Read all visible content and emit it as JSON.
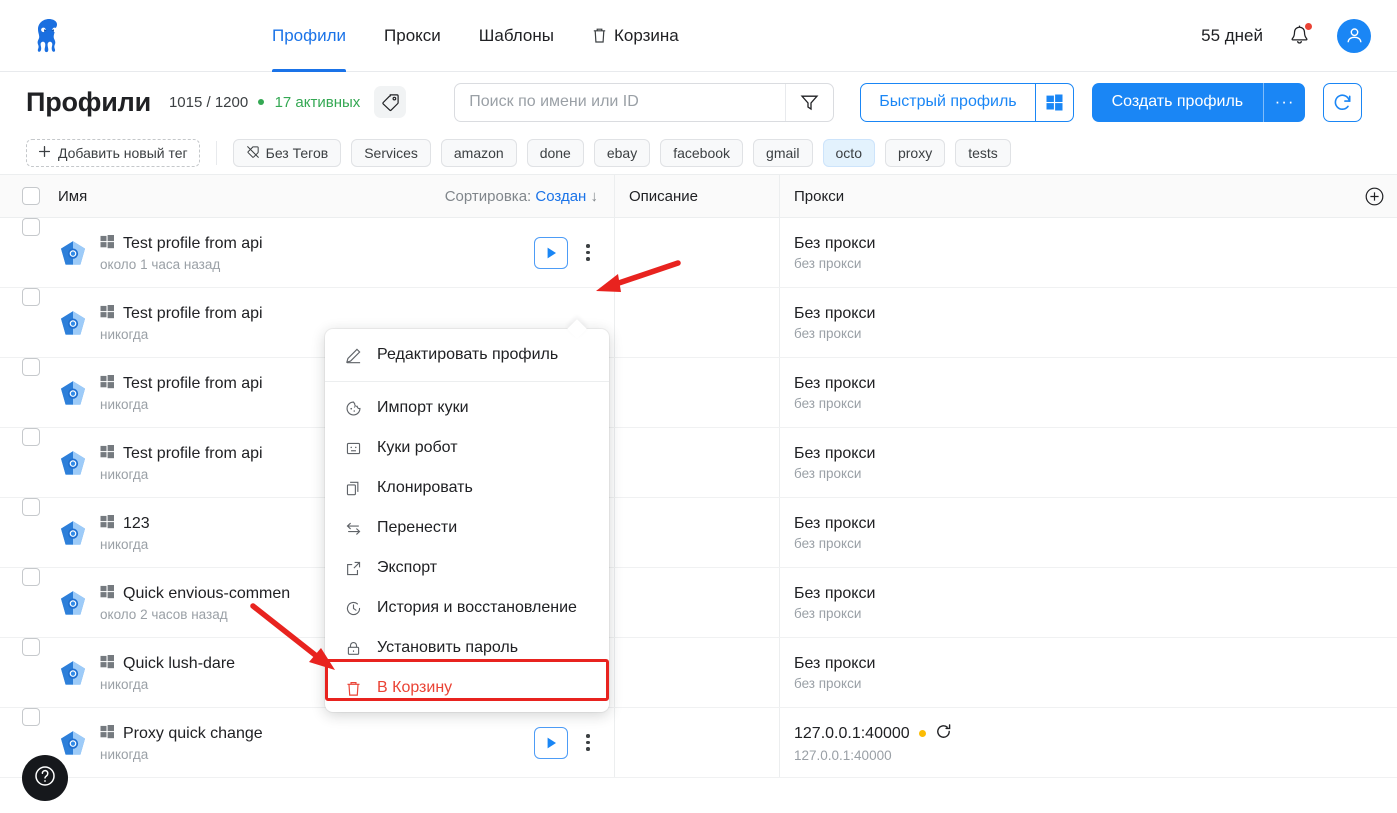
{
  "header": {
    "logo_icon": "octo-browser-logo",
    "nav": [
      {
        "label": "Профили",
        "icon": null,
        "active": true
      },
      {
        "label": "Прокси",
        "icon": null,
        "active": false
      },
      {
        "label": "Шаблоны",
        "icon": null,
        "active": false
      },
      {
        "label": "Корзина",
        "icon": "trash-icon",
        "active": false
      }
    ],
    "days_left": "55 дней",
    "bell_icon": "notification-bell-icon",
    "has_notification": true,
    "avatar_icon": "user-avatar-icon"
  },
  "toolbar": {
    "title": "Профили",
    "count": "1015 / 1200",
    "active_count": "17 активных",
    "tag_icon": "tag-icon",
    "search_placeholder": "Поиск по имени или ID",
    "search_value": "",
    "filter_icon": "funnel-icon",
    "quick_profile_label": "Быстрый профиль",
    "windows_icon": "windows-icon",
    "create_profile_label": "Создать профиль",
    "more_label": "···",
    "refresh_icon": "refresh-icon"
  },
  "tags": {
    "add_label": "Добавить новый тег",
    "no_tag_label": "Без Тегов",
    "no_tag_icon": "tag-off-icon",
    "items": [
      {
        "label": "Services",
        "selected": false
      },
      {
        "label": "amazon",
        "selected": false
      },
      {
        "label": "done",
        "selected": false
      },
      {
        "label": "ebay",
        "selected": false
      },
      {
        "label": "facebook",
        "selected": false
      },
      {
        "label": "gmail",
        "selected": false
      },
      {
        "label": "octo",
        "selected": true
      },
      {
        "label": "proxy",
        "selected": false
      },
      {
        "label": "tests",
        "selected": false
      }
    ]
  },
  "table": {
    "columns": {
      "name": "Имя",
      "description": "Описание",
      "proxy": "Прокси"
    },
    "sort_label": "Сортировка:",
    "sort_value": "Создан",
    "sort_dir_icon": "arrow-down-icon",
    "add_column_icon": "plus-circle-icon",
    "rows": [
      {
        "name": "Test profile from api",
        "time": "около 1 часа назад",
        "os_icon": "windows-icon",
        "browser_icon": "octo-profile-icon",
        "proxy": "Без прокси",
        "proxy_sub": "без прокси",
        "proxy_status": null
      },
      {
        "name": "Test profile from api",
        "time": "никогда",
        "os_icon": "windows-icon",
        "browser_icon": "octo-profile-icon",
        "proxy": "Без прокси",
        "proxy_sub": "без прокси",
        "proxy_status": null
      },
      {
        "name": "Test profile from api",
        "time": "никогда",
        "os_icon": "windows-icon",
        "browser_icon": "octo-profile-icon",
        "proxy": "Без прокси",
        "proxy_sub": "без прокси",
        "proxy_status": null
      },
      {
        "name": "Test profile from api",
        "time": "никогда",
        "os_icon": "windows-icon",
        "browser_icon": "octo-profile-icon",
        "proxy": "Без прокси",
        "proxy_sub": "без прокси",
        "proxy_status": null
      },
      {
        "name": "123",
        "time": "никогда",
        "os_icon": "windows-icon",
        "browser_icon": "octo-profile-icon",
        "proxy": "Без прокси",
        "proxy_sub": "без прокси",
        "proxy_status": null
      },
      {
        "name": "Quick envious-commen",
        "time": "около 2 часов назад",
        "os_icon": "windows-icon",
        "browser_icon": "octo-profile-icon",
        "proxy": "Без прокси",
        "proxy_sub": "без прокси",
        "proxy_status": null
      },
      {
        "name": "Quick lush-dare",
        "time": "никогда",
        "os_icon": "windows-icon",
        "browser_icon": "octo-profile-icon",
        "proxy": "Без прокси",
        "proxy_sub": "без прокси",
        "proxy_status": null
      },
      {
        "name": "Proxy quick change",
        "time": "никогда",
        "os_icon": "windows-icon",
        "browser_icon": "octo-profile-icon",
        "proxy": "127.0.0.1:40000",
        "proxy_sub": "127.0.0.1:40000",
        "proxy_status": "amber"
      }
    ]
  },
  "context_menu": {
    "items": [
      {
        "label": "Редактировать профиль",
        "icon": "pencil-icon",
        "danger": false
      },
      {
        "label": "Импорт куки",
        "icon": "cookie-icon",
        "danger": false
      },
      {
        "label": "Куки робот",
        "icon": "robot-icon",
        "danger": false
      },
      {
        "label": "Клонировать",
        "icon": "copy-icon",
        "danger": false
      },
      {
        "label": "Перенести",
        "icon": "transfer-icon",
        "danger": false
      },
      {
        "label": "Экспорт",
        "icon": "export-icon",
        "danger": false
      },
      {
        "label": "История и восстановление",
        "icon": "history-icon",
        "danger": false
      },
      {
        "label": "Установить пароль",
        "icon": "lock-icon",
        "danger": false
      },
      {
        "label": "В Корзину",
        "icon": "trash-icon",
        "danger": true
      }
    ],
    "highlight_color": "#e8231f",
    "danger_color": "#ea4335"
  },
  "help": {
    "icon": "question-mark-icon"
  },
  "colors": {
    "accent": "#1a86f5",
    "link": "#1a73e8",
    "success": "#34a853",
    "danger": "#ea4335",
    "warning": "#fbbc04"
  }
}
